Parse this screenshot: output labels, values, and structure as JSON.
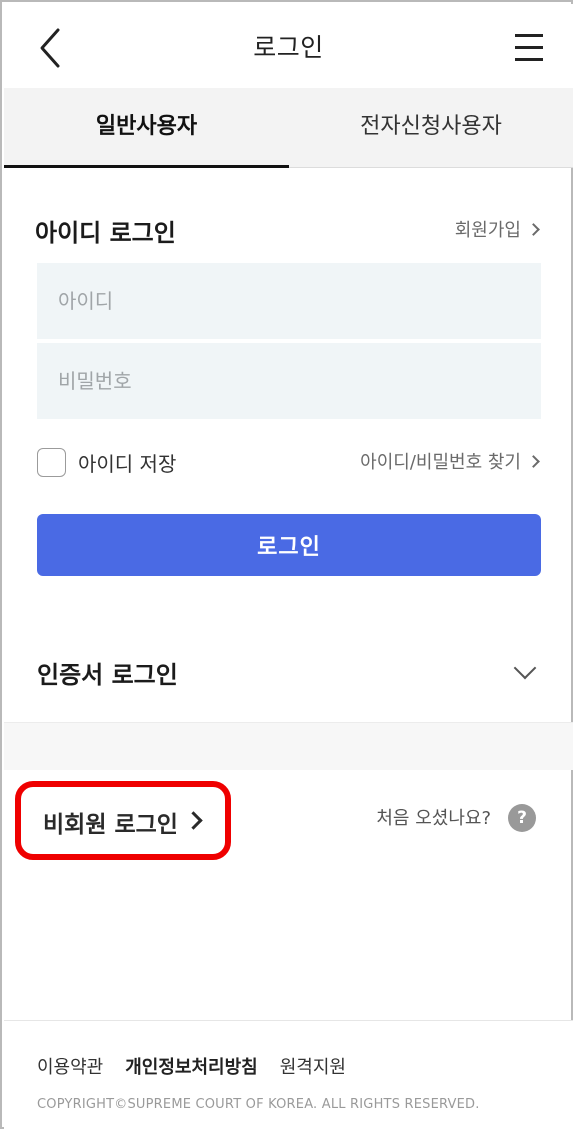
{
  "header": {
    "title": "로그인",
    "back_icon": "chevron-left-icon",
    "menu_icon": "hamburger-menu-icon"
  },
  "tabs": [
    {
      "label": "일반사용자",
      "active": true
    },
    {
      "label": "전자신청사용자",
      "active": false
    }
  ],
  "id_login": {
    "title": "아이디 로그인",
    "signup_link": "회원가입",
    "id_placeholder": "아이디",
    "password_placeholder": "비밀번호",
    "save_id_label": "아이디 저장",
    "save_id_checked": false,
    "find_link": "아이디/비밀번호 찾기",
    "login_button": "로그인"
  },
  "cert_login": {
    "title": "인증서 로그인",
    "expand_icon": "chevron-down-icon"
  },
  "guest_login": {
    "label": "비회원 로그인",
    "first_visit_text": "처음 오셨나요?",
    "help_icon_glyph": "?",
    "highlight_color": "#ef0000"
  },
  "footer": {
    "links": [
      "이용약관",
      "개인정보처리방침",
      "원격지원"
    ],
    "copyright": "COPYRIGHT©SUPREME COURT OF KOREA. ALL RIGHTS RESERVED."
  },
  "colors": {
    "primary_button": "#4a6ae4",
    "input_background": "#f0f5f7"
  }
}
